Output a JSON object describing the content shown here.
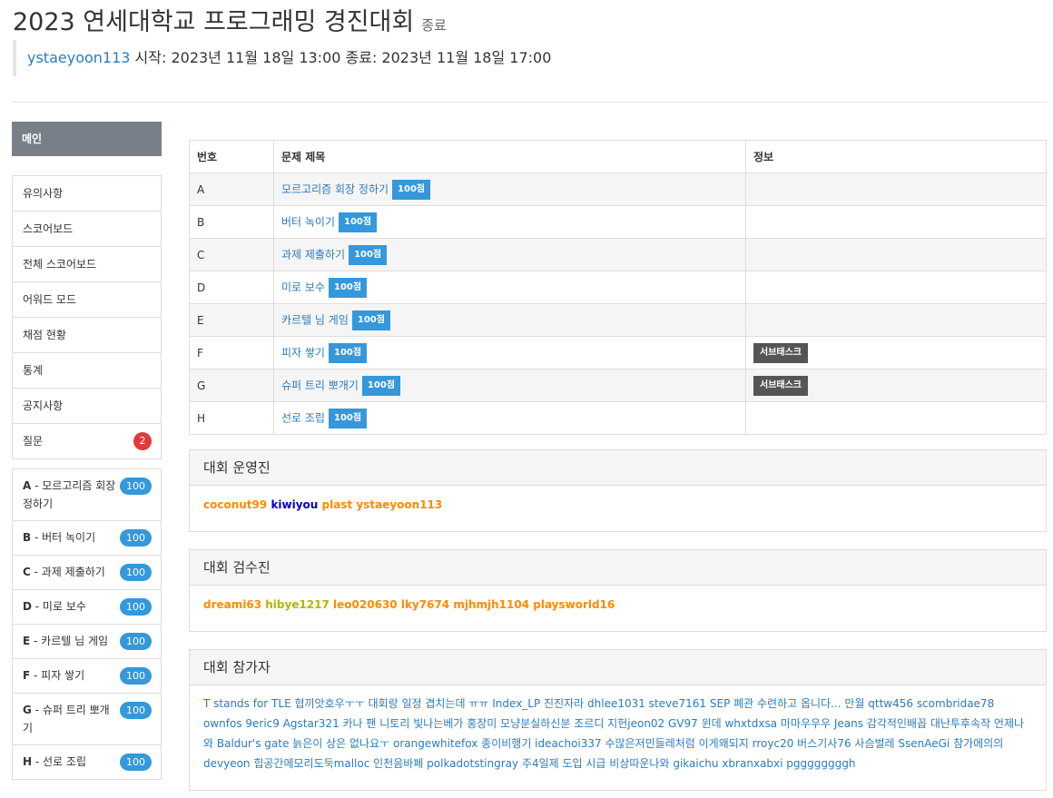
{
  "header": {
    "title": "2023 연세대학교 프로그래밍 경진대회",
    "status": "종료",
    "author": "ystaeyoon113",
    "schedule": "시작: 2023년 11월 18일 13:00 종료: 2023년 11월 18일 17:00"
  },
  "sidebar": {
    "main_label": "메인",
    "nav": [
      {
        "label": "유의사항"
      },
      {
        "label": "스코어보드"
      },
      {
        "label": "전체 스코어보드"
      },
      {
        "label": "어워드 모드"
      },
      {
        "label": "채점 현황"
      },
      {
        "label": "통계"
      },
      {
        "label": "공지사항"
      },
      {
        "label": "질문",
        "badge": "2"
      }
    ],
    "problems": [
      {
        "id": "A",
        "name": " - 모르고리즘 회장 정하기",
        "score": "100"
      },
      {
        "id": "B",
        "name": " - 버터 녹이기",
        "score": "100"
      },
      {
        "id": "C",
        "name": " - 과제 제출하기",
        "score": "100"
      },
      {
        "id": "D",
        "name": " - 미로 보수",
        "score": "100"
      },
      {
        "id": "E",
        "name": " - 카르텔 님 게임",
        "score": "100"
      },
      {
        "id": "F",
        "name": " - 피자 쌓기",
        "score": "100"
      },
      {
        "id": "G",
        "name": " - 슈퍼 트리 뽀개기",
        "score": "100"
      },
      {
        "id": "H",
        "name": " - 선로 조립",
        "score": "100"
      }
    ]
  },
  "problem_table": {
    "headers": [
      "번호",
      "문제 제목",
      "정보"
    ],
    "rows": [
      {
        "id": "A",
        "title": "모르고리즘 회장 정하기",
        "score": "100점",
        "info": ""
      },
      {
        "id": "B",
        "title": "버터 녹이기",
        "score": "100점",
        "info": ""
      },
      {
        "id": "C",
        "title": "과제 제출하기",
        "score": "100점",
        "info": ""
      },
      {
        "id": "D",
        "title": "미로 보수",
        "score": "100점",
        "info": ""
      },
      {
        "id": "E",
        "title": "카르텔 님 게임",
        "score": "100점",
        "info": ""
      },
      {
        "id": "F",
        "title": "피자 쌓기",
        "score": "100점",
        "info": "서브태스크"
      },
      {
        "id": "G",
        "title": "슈퍼 트리 뽀개기",
        "score": "100점",
        "info": "서브태스크"
      },
      {
        "id": "H",
        "title": "선로 조립",
        "score": "100점",
        "info": ""
      }
    ]
  },
  "staff": {
    "title": "대회 운영진",
    "users": [
      {
        "name": "coconut99",
        "color": "#ff8a00"
      },
      {
        "name": "kiwiyou",
        "color": "#0000cc"
      },
      {
        "name": "plast",
        "color": "#ff8a00"
      },
      {
        "name": "ystaeyoon113",
        "color": "#ff8a00"
      }
    ]
  },
  "reviewers": {
    "title": "대회 검수진",
    "users": [
      {
        "name": "dreami63",
        "color": "#ff8a00"
      },
      {
        "name": "hibye1217",
        "color": "#b5b500"
      },
      {
        "name": "leo020630",
        "color": "#ff8a00"
      },
      {
        "name": "lky7674",
        "color": "#ff8a00"
      },
      {
        "name": "mjhmjh1104",
        "color": "#ff8a00"
      },
      {
        "name": "playsworld16",
        "color": "#ff8a00"
      }
    ]
  },
  "participants": {
    "title": "대회 참가자",
    "text": "T stands for TLE 협끼앗호우ㅜㅜ 대회랑 일정 겹치는데 ㅠㅠ Index_LP 진진자라 dhlee1031 steve7161 SEP 폐관 수련하고 옵니다... 만월 qttw456 scombridae78 ownfos 9eric9 Agstar321 카나 팬 니토리 빛나는베가 홍장미 모냥분실하신분 조르디 지헌jeon02 GV97 윈데 whxtdxsa 마마우우우 Jeans 감각적인배꼽 대난투후속작 언제나와 Baldur's gate 늙은이 상은 없나요ㅜ orangewhitefox 종이비행기 ideachoi337 수많은저민들레처럼 이게왜되지 rroyc20 버스기사76 사슴벌레 SsenAeGi 참가에의의 devyeon 힙공간메모리도둑malloc 인천음바페 polkadotstingray 주4일제 도입 시급 비상따운나와 gikaichu xbranxabxi pggggggggh"
  },
  "colors": {
    "link": "#2a7bbf",
    "score_badge": "#3498db",
    "question_badge": "#e03a3a",
    "menu_active": "#787f88"
  }
}
